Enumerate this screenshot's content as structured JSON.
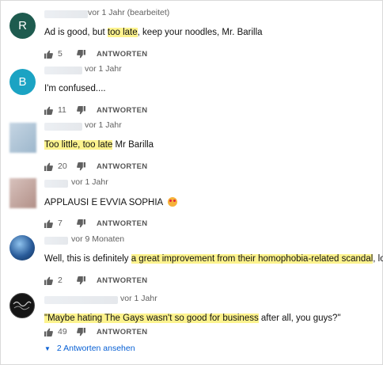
{
  "reply_label": "ANTWORTEN",
  "comments": [
    {
      "avatar_letter": "R",
      "avatar_color": "#1e5b4f",
      "time": "vor 1 Jahr (bearbeitet)",
      "parts": [
        "Ad is good, but ",
        "too late",
        ", keep your noodles, Mr. Barilla"
      ],
      "likes": "5"
    },
    {
      "avatar_letter": "B",
      "avatar_color": "#1ba3c3",
      "time": "vor 1 Jahr",
      "parts": [
        "I'm confused...."
      ],
      "likes": "11"
    },
    {
      "avatar_letter": "",
      "avatar_color": "#a9c1d6",
      "time": "vor 1 Jahr",
      "parts": [
        "Too little, too late",
        " Mr Barilla"
      ],
      "likes": "20"
    },
    {
      "avatar_letter": "",
      "avatar_color": "#c9aaa3",
      "time": "vor 1 Jahr",
      "parts": [
        "APPLAUSI E EVVIA SOPHIA "
      ],
      "likes": "7"
    },
    {
      "avatar_letter": "",
      "avatar_color": "#2a5c9a",
      "time": "vor 9 Monaten",
      "parts": [
        "Well, this is definitely ",
        "a great improvement from their homophobia-related scandal",
        ", lol..."
      ],
      "likes": "2"
    },
    {
      "avatar_letter": "",
      "avatar_color": "#151515",
      "time": "vor 1 Jahr",
      "parts": [
        "\"Maybe hating The Gays wasn't so good for business",
        " after all, you guys?\""
      ],
      "likes": "49"
    }
  ],
  "view_replies": "2 Antworten ansehen",
  "colors": {
    "highlight": "#fdf38e",
    "link": "#065fd4",
    "muted": "#606060"
  }
}
